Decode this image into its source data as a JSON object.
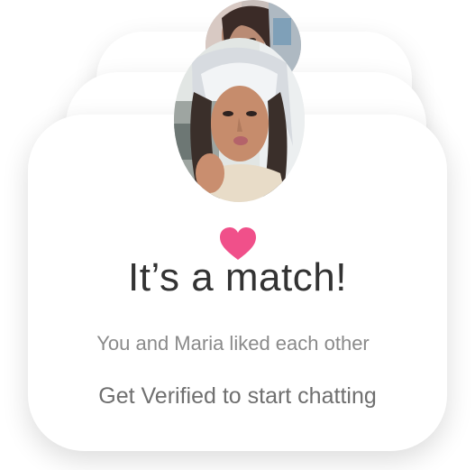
{
  "match": {
    "title": "It’s a match!",
    "subtitle": "You and Maria liked each other",
    "cta": "Get Verified to start chatting"
  },
  "icons": {
    "heart": "heart-icon"
  },
  "colors": {
    "heart": "#f0508a",
    "title_text": "#333333",
    "subtitle_text": "#8a8a8a",
    "cta_text": "#6f6f6f",
    "card_background": "#ffffff"
  }
}
